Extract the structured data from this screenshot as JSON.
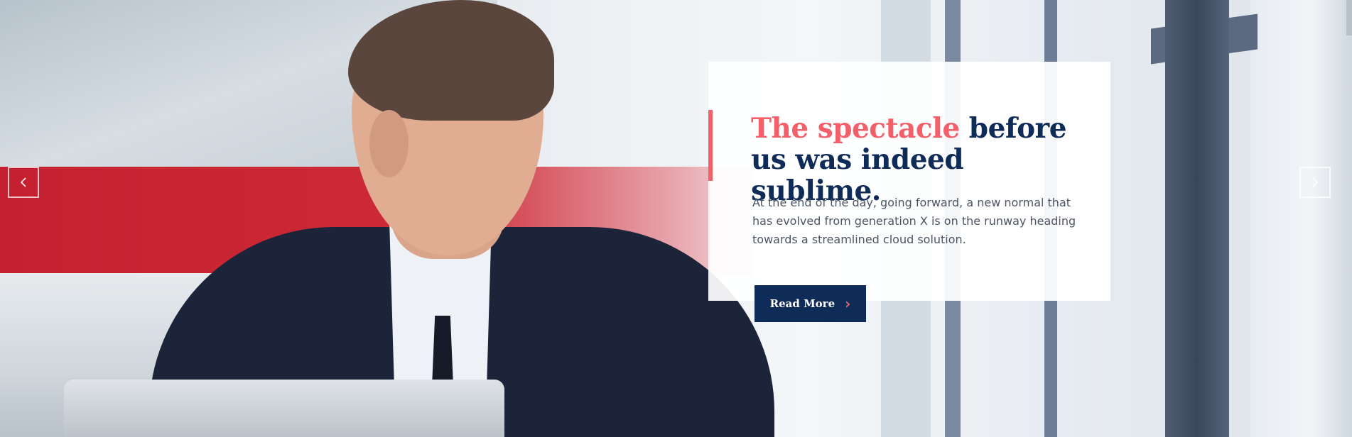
{
  "slider": {
    "headline_highlight": "The spectacle",
    "headline_rest": " before us was indeed sublime.",
    "description": "At the end of the day, going forward, a new normal that has evolved from generation X is on the runway heading towards a streamlined cloud solution.",
    "cta_label": "Read More",
    "cta_icon": "chevron-right-icon",
    "prev_icon": "chevron-left-icon",
    "next_icon": "chevron-right-icon"
  },
  "colors": {
    "accent": "#f4606a",
    "navy": "#0f2b57",
    "body_text": "#4c5563"
  }
}
